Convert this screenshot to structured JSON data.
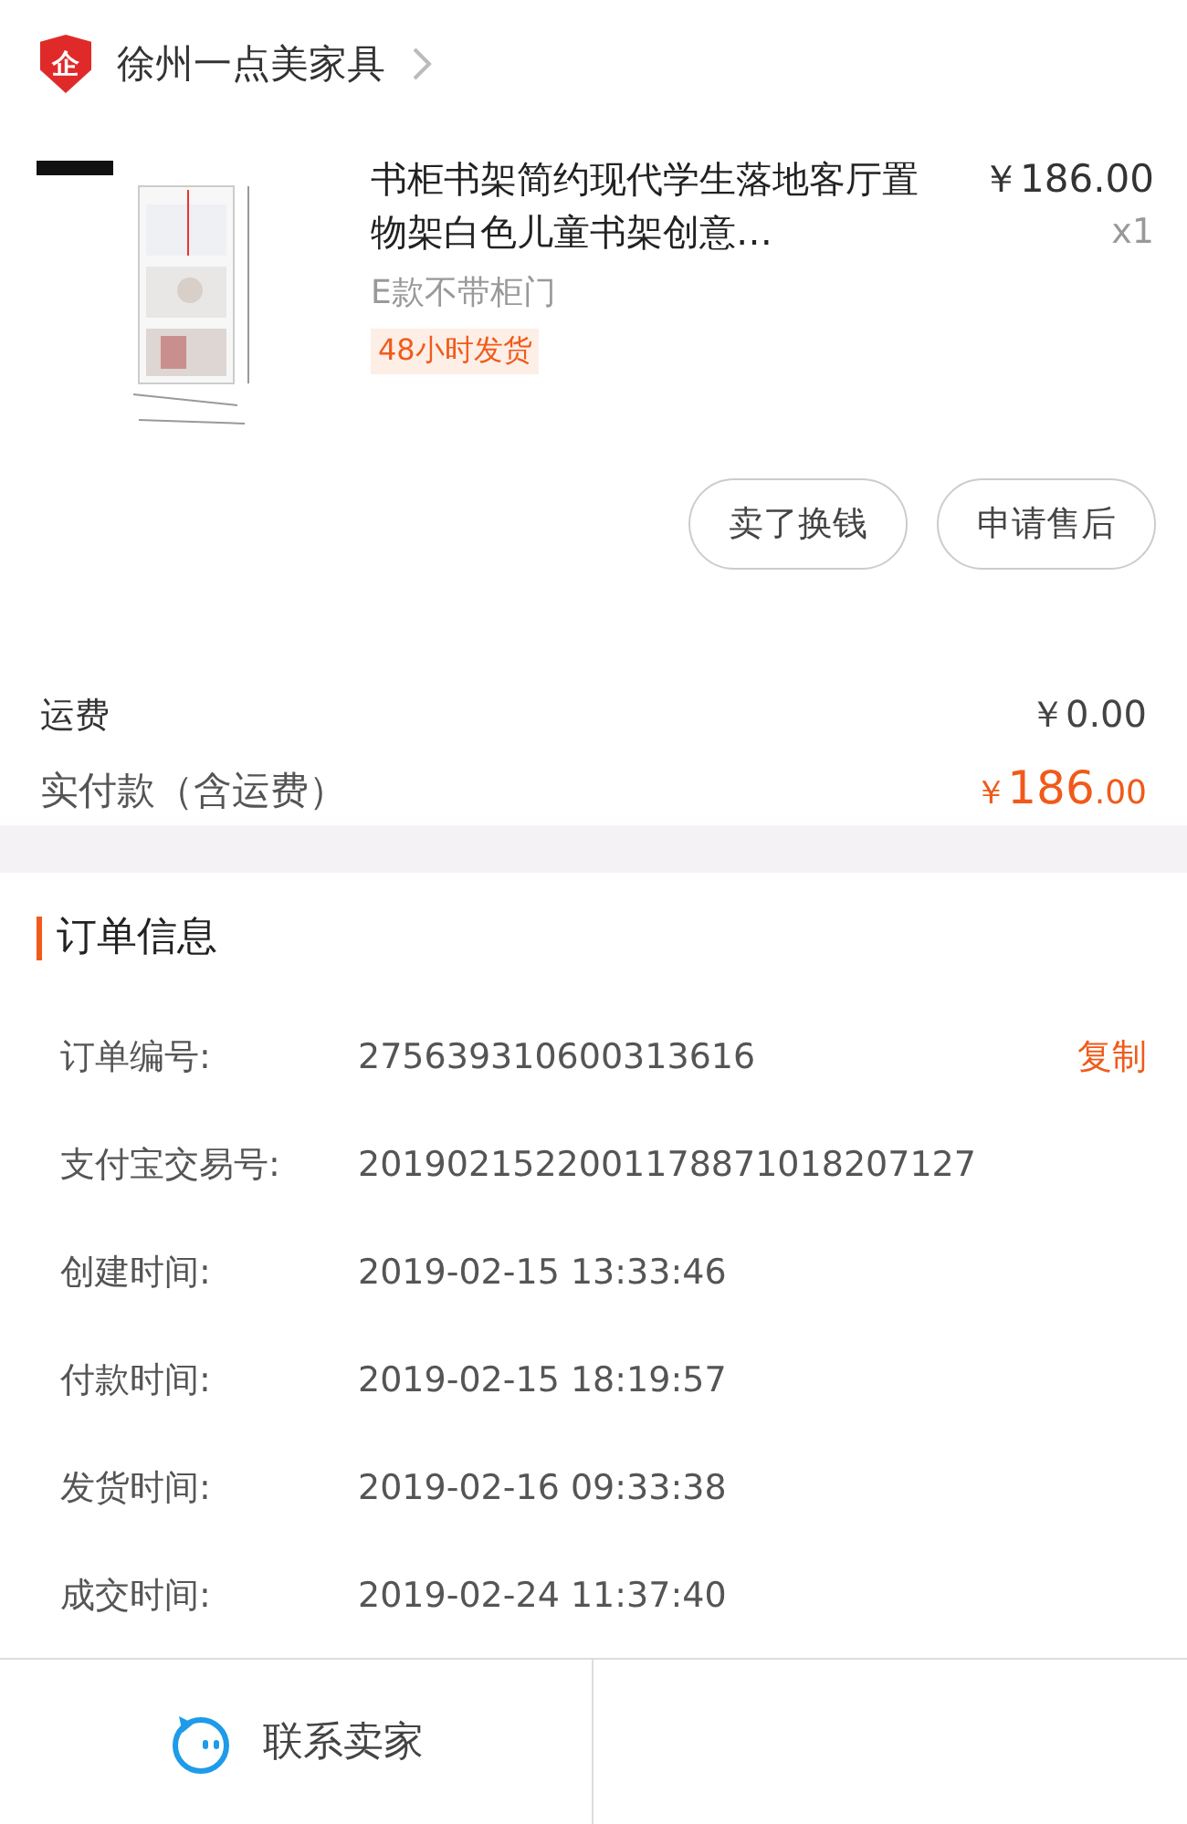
{
  "shop": {
    "name": "徐州一点美家具",
    "badge": "企"
  },
  "product": {
    "title": "书柜书架简约现代学生落地客厅置物架白色儿童书架创意…",
    "price": "￥186.00",
    "quantity": "x1",
    "variant": "E款不带柜门",
    "tag": "48小时发货"
  },
  "actions": [
    "卖了换钱",
    "申请售后"
  ],
  "summary": {
    "freight_label": "运费",
    "freight": "￥0.00",
    "paid_label": "实付款（含运费）",
    "paid_currency": "￥",
    "paid_integer": "186",
    "paid_decimal": ".00"
  },
  "order_info": {
    "title": "订单信息",
    "rows": [
      {
        "label": "订单编号:",
        "value": "275639310600313616",
        "action": "复制"
      },
      {
        "label": "支付宝交易号:",
        "value": "2019021522001178871018207127"
      },
      {
        "label": "创建时间:",
        "value": "2019-02-15 13:33:46"
      },
      {
        "label": "付款时间:",
        "value": "2019-02-15 18:19:57"
      },
      {
        "label": "发货时间:",
        "value": "2019-02-16 09:33:38"
      },
      {
        "label": "成交时间:",
        "value": "2019-02-24 11:37:40"
      }
    ]
  },
  "footer": {
    "contact": "联系卖家"
  }
}
